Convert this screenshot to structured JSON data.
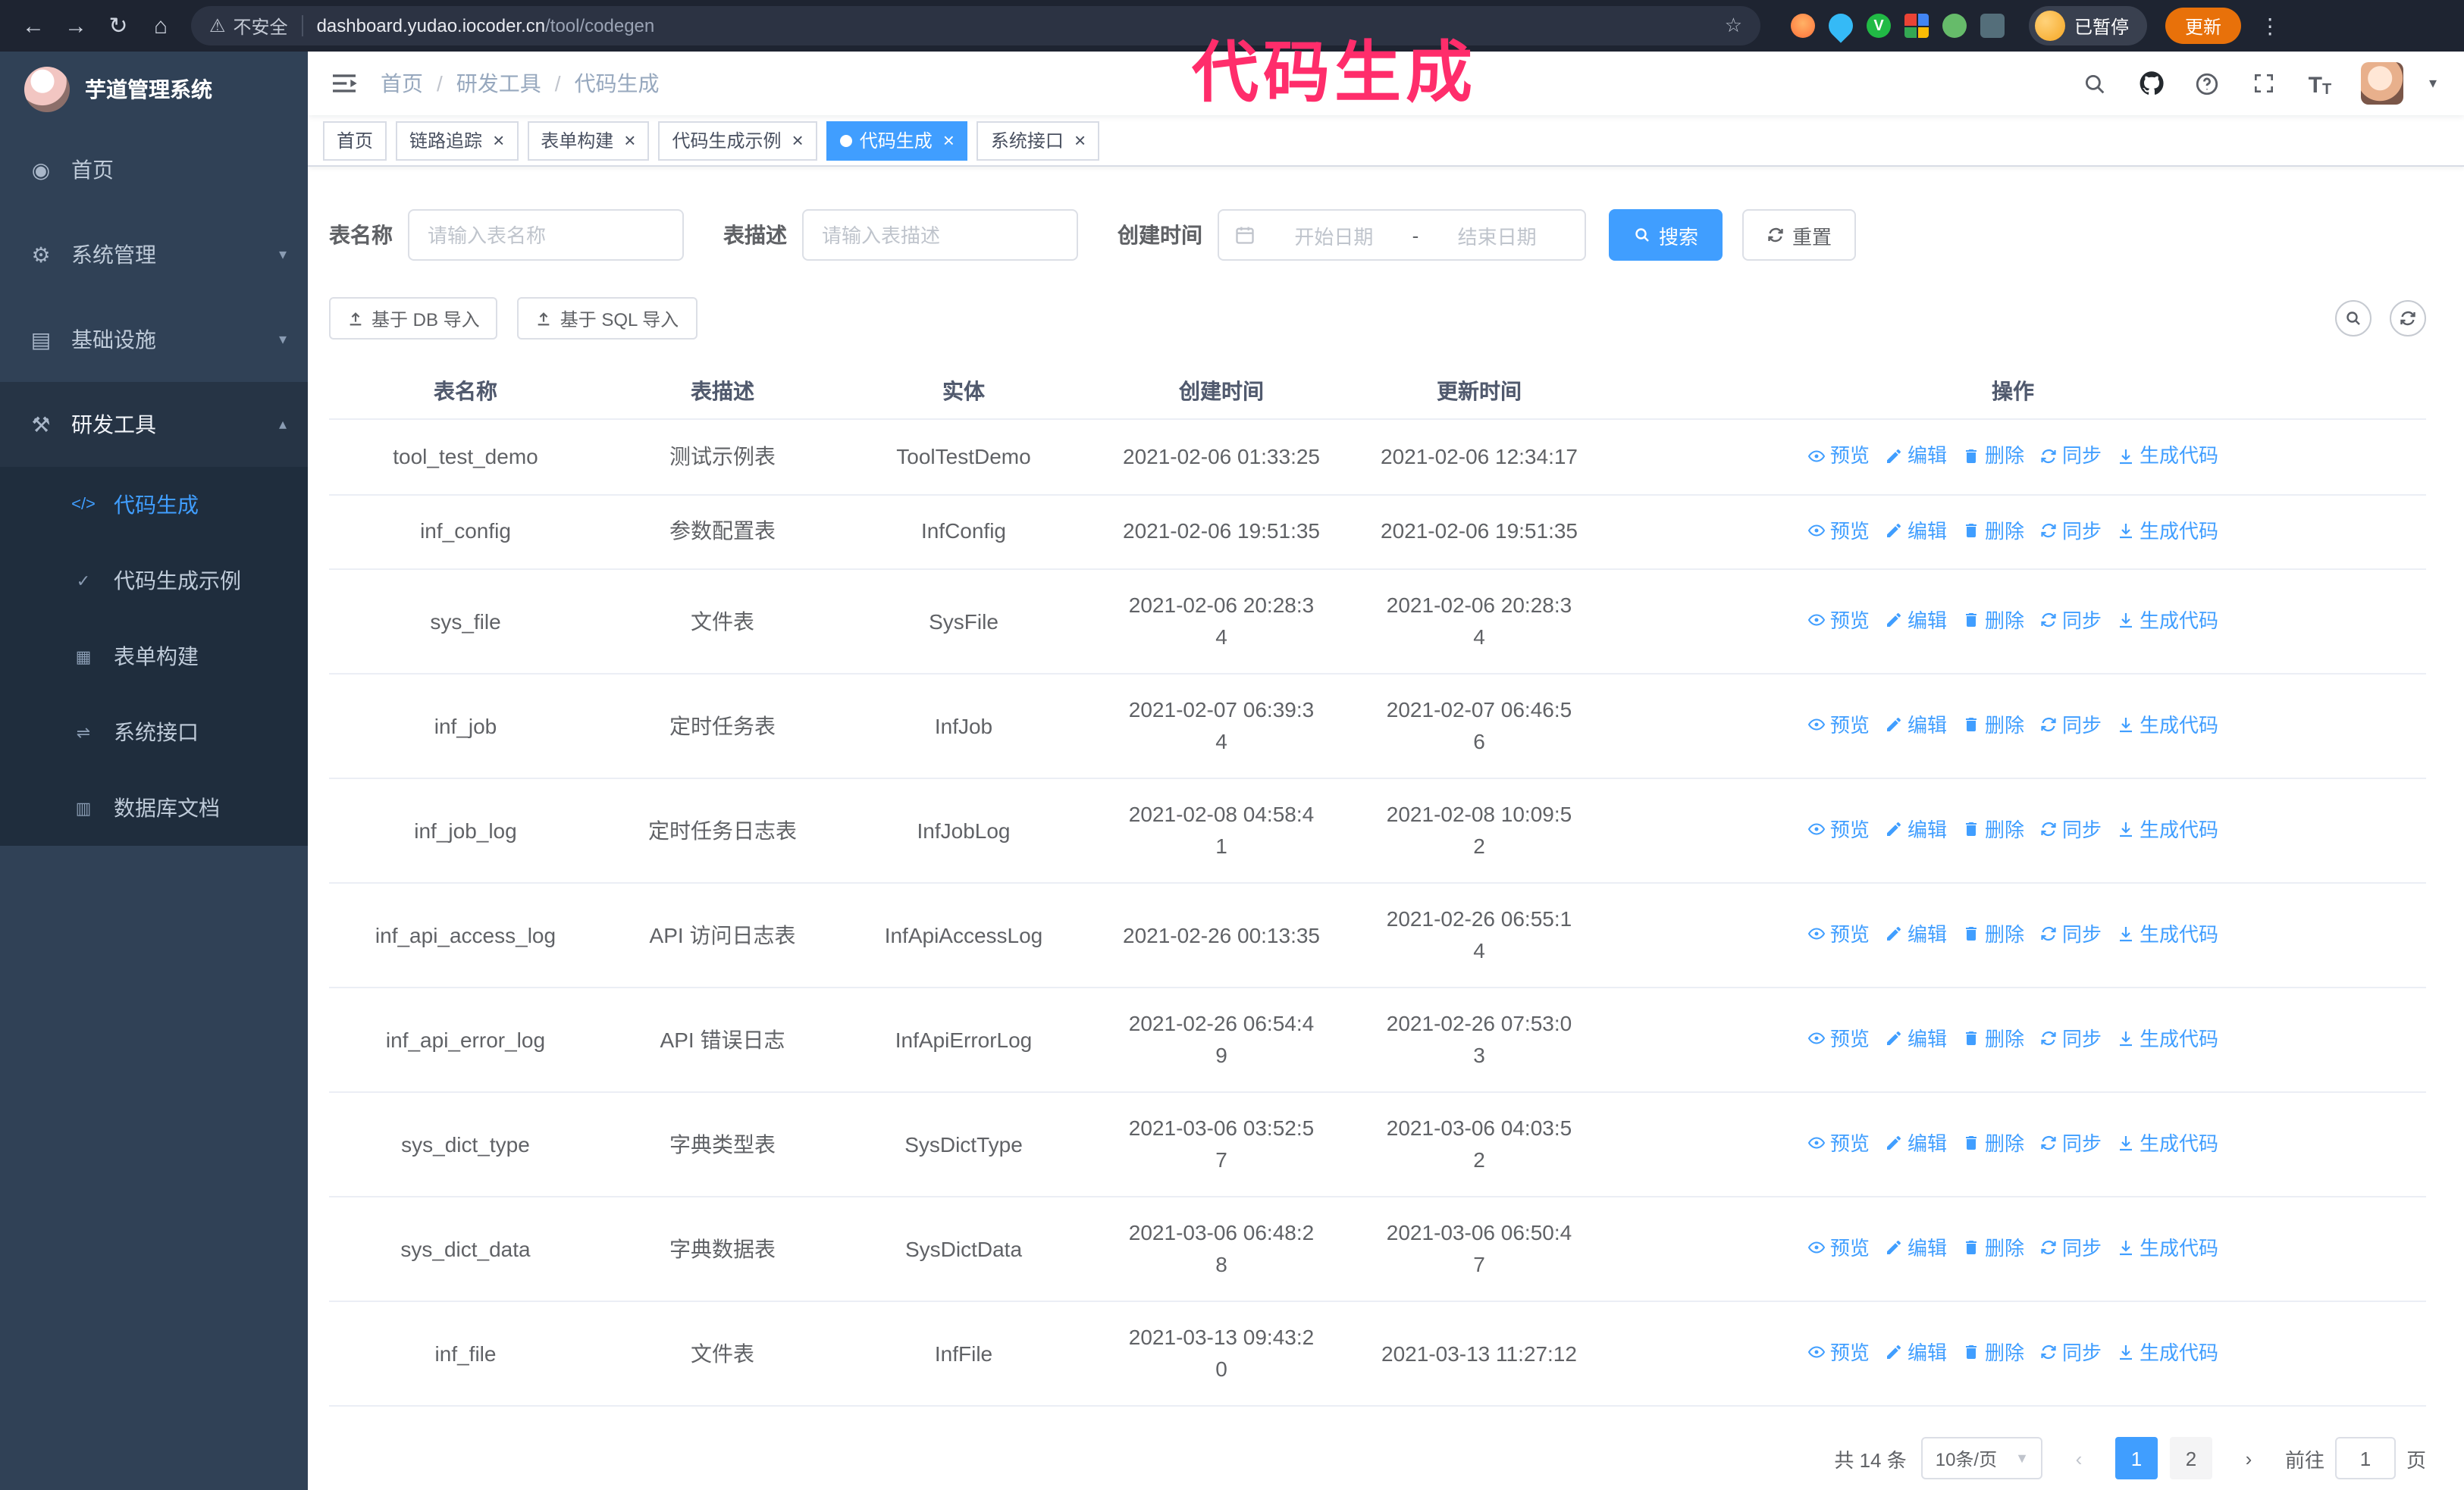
{
  "annotation": {
    "text": "代码生成",
    "color": "#ff2d6b"
  },
  "colors": {
    "primary": "#409eff",
    "sidebar_bg": "#304156",
    "submenu_bg": "#1f2d3d",
    "update_button": "#e8710a",
    "annotation": "#ff2d6b"
  },
  "browser": {
    "security_label": "不安全",
    "url_host": "dashboard.yudao.iocoder.cn",
    "url_path": "/tool/codegen",
    "profile_badge": "已暂停",
    "update_button": "更新"
  },
  "sidebar": {
    "app_title": "芋道管理系统",
    "items": [
      {
        "id": "home",
        "label": "首页",
        "icon": "dashboard-icon"
      },
      {
        "id": "system",
        "label": "系统管理",
        "icon": "gear-icon",
        "expandable": true
      },
      {
        "id": "infra",
        "label": "基础设施",
        "icon": "infra-icon",
        "expandable": true
      },
      {
        "id": "dev-tools",
        "label": "研发工具",
        "icon": "tools-icon",
        "expandable": true,
        "expanded": true,
        "children": [
          {
            "id": "codegen",
            "label": "代码生成",
            "icon": "code-icon",
            "active": true
          },
          {
            "id": "codegen-example",
            "label": "代码生成示例",
            "icon": "example-icon"
          },
          {
            "id": "form-builder",
            "label": "表单构建",
            "icon": "form-icon"
          },
          {
            "id": "system-api",
            "label": "系统接口",
            "icon": "api-icon"
          },
          {
            "id": "db-doc",
            "label": "数据库文档",
            "icon": "docs-icon"
          }
        ]
      }
    ]
  },
  "header": {
    "breadcrumb": [
      "首页",
      "研发工具",
      "代码生成"
    ]
  },
  "tabs": [
    {
      "id": "home",
      "label": "首页",
      "closable": false,
      "active": false
    },
    {
      "id": "tracer",
      "label": "链路追踪",
      "closable": true,
      "active": false
    },
    {
      "id": "form-builder",
      "label": "表单构建",
      "closable": true,
      "active": false
    },
    {
      "id": "codegen-example",
      "label": "代码生成示例",
      "closable": true,
      "active": false
    },
    {
      "id": "codegen",
      "label": "代码生成",
      "closable": true,
      "active": true
    },
    {
      "id": "system-api",
      "label": "系统接口",
      "closable": true,
      "active": false
    }
  ],
  "filters": {
    "table_name_label": "表名称",
    "table_name_placeholder": "请输入表名称",
    "table_desc_label": "表描述",
    "table_desc_placeholder": "请输入表描述",
    "create_time_label": "创建时间",
    "start_date_placeholder": "开始日期",
    "range_separator": "-",
    "end_date_placeholder": "结束日期",
    "search_label": "搜索",
    "reset_label": "重置"
  },
  "toolbar": {
    "import_db_label": "基于 DB 导入",
    "import_sql_label": "基于 SQL 导入"
  },
  "table": {
    "columns": [
      "表名称",
      "表描述",
      "实体",
      "创建时间",
      "更新时间",
      "操作"
    ],
    "actions": [
      "预览",
      "编辑",
      "删除",
      "同步",
      "生成代码"
    ],
    "rows": [
      {
        "name": "tool_test_demo",
        "desc": "测试示例表",
        "entity": "ToolTestDemo",
        "created": "2021-02-06 01:33:25",
        "updated": "2021-02-06 12:34:17"
      },
      {
        "name": "inf_config",
        "desc": "参数配置表",
        "entity": "InfConfig",
        "created": "2021-02-06 19:51:35",
        "updated": "2021-02-06 19:51:35"
      },
      {
        "name": "sys_file",
        "desc": "文件表",
        "entity": "SysFile",
        "created": "2021-02-06 20:28:3\n4",
        "updated": "2021-02-06 20:28:3\n4"
      },
      {
        "name": "inf_job",
        "desc": "定时任务表",
        "entity": "InfJob",
        "created": "2021-02-07 06:39:3\n4",
        "updated": "2021-02-07 06:46:5\n6"
      },
      {
        "name": "inf_job_log",
        "desc": "定时任务日志表",
        "entity": "InfJobLog",
        "created": "2021-02-08 04:58:4\n1",
        "updated": "2021-02-08 10:09:5\n2"
      },
      {
        "name": "inf_api_access_log",
        "desc": "API 访问日志表",
        "entity": "InfApiAccessLog",
        "created": "2021-02-26 00:13:35",
        "updated": "2021-02-26 06:55:1\n4"
      },
      {
        "name": "inf_api_error_log",
        "desc": "API 错误日志",
        "entity": "InfApiErrorLog",
        "created": "2021-02-26 06:54:4\n9",
        "updated": "2021-02-26 07:53:0\n3"
      },
      {
        "name": "sys_dict_type",
        "desc": "字典类型表",
        "entity": "SysDictType",
        "created": "2021-03-06 03:52:5\n7",
        "updated": "2021-03-06 04:03:5\n2"
      },
      {
        "name": "sys_dict_data",
        "desc": "字典数据表",
        "entity": "SysDictData",
        "created": "2021-03-06 06:48:2\n8",
        "updated": "2021-03-06 06:50:4\n7"
      },
      {
        "name": "inf_file",
        "desc": "文件表",
        "entity": "InfFile",
        "created": "2021-03-13 09:43:2\n0",
        "updated": "2021-03-13 11:27:12"
      }
    ]
  },
  "pagination": {
    "total_text": "共 14 条",
    "page_size": "10条/页",
    "pages": [
      "1",
      "2"
    ],
    "active_page": "1",
    "goto_label": "前往",
    "goto_value": "1",
    "goto_suffix": "页"
  }
}
